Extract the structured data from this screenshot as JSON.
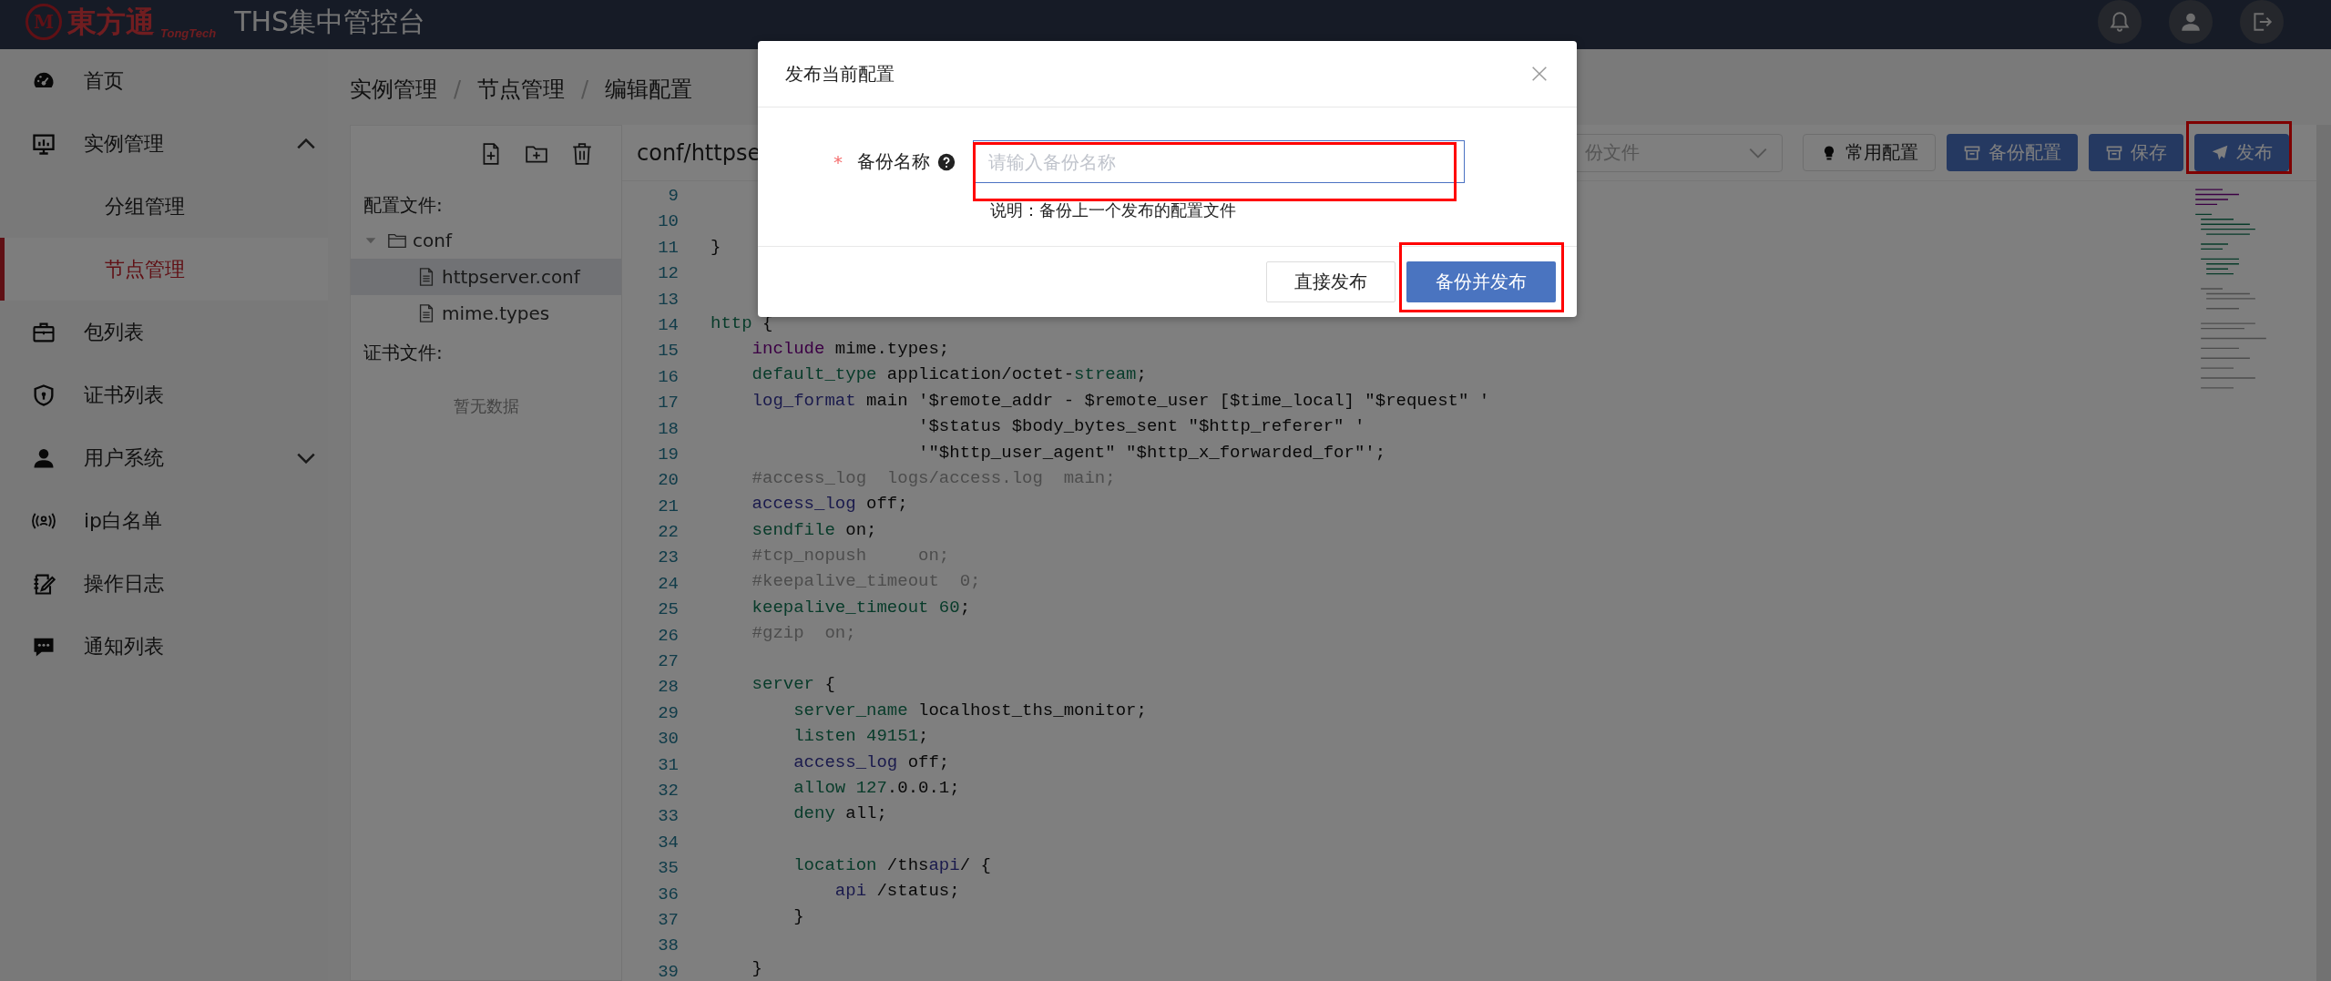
{
  "header": {
    "logo_mark": "M",
    "logo_text": "東方通",
    "logo_subtext": "TongTech",
    "title": "THS集中管控台"
  },
  "sidebar": {
    "items": [
      {
        "label": "首页",
        "kind": "link",
        "selected": false
      },
      {
        "label": "实例管理",
        "kind": "group",
        "selected": false,
        "expanded": true,
        "children": [
          {
            "label": "分组管理",
            "selected": false
          },
          {
            "label": "节点管理",
            "selected": true
          }
        ]
      },
      {
        "label": "包列表",
        "kind": "link",
        "selected": false
      },
      {
        "label": "证书列表",
        "kind": "link",
        "selected": false
      },
      {
        "label": "用户系统",
        "kind": "group",
        "selected": false,
        "expanded": false
      },
      {
        "label": "ip白名单",
        "kind": "link",
        "selected": false
      },
      {
        "label": "操作日志",
        "kind": "link",
        "selected": false
      },
      {
        "label": "通知列表",
        "kind": "link",
        "selected": false
      }
    ]
  },
  "breadcrumb": [
    {
      "kind": "link",
      "text": "实例管理"
    },
    {
      "kind": "separator",
      "text": "/"
    },
    {
      "kind": "link",
      "text": "节点管理"
    },
    {
      "kind": "separator",
      "text": "/"
    },
    {
      "kind": "current",
      "text": "编辑配置"
    }
  ],
  "file_panel": {
    "sections": [
      {
        "title": "配置文件:",
        "tree": [
          {
            "label": "conf",
            "kind": "folder",
            "expanded": true,
            "selected": false,
            "children": [
              {
                "label": "httpserver.conf",
                "kind": "file",
                "selected": true
              },
              {
                "label": "mime.types",
                "kind": "file",
                "selected": false
              }
            ]
          }
        ]
      },
      {
        "title": "证书文件:",
        "empty_text": "暂无数据"
      }
    ]
  },
  "editor": {
    "title": "conf/httpse",
    "backup_select": {
      "placeholder": "份文件"
    },
    "buttons": [
      {
        "label": "常用配置",
        "kind": "plain",
        "highlighted": false
      },
      {
        "label": "备份配置",
        "kind": "primary",
        "highlighted": false
      },
      {
        "label": "保存",
        "kind": "primary",
        "highlighted": false
      },
      {
        "label": "发布",
        "kind": "primary",
        "highlighted": true
      }
    ],
    "lines": [
      {
        "number": "9"
      },
      {
        "number": "10"
      },
      {
        "number": "11",
        "tokens": [
          {
            "kind": "plain",
            "text": "}"
          }
        ]
      },
      {
        "number": "12"
      },
      {
        "number": "13"
      },
      {
        "number": "14",
        "tokens": [
          {
            "kind": "directive",
            "text": "http"
          },
          {
            "kind": "plain",
            "text": " {"
          }
        ]
      },
      {
        "number": "15",
        "tokens": [
          {
            "kind": "include",
            "text": "    include"
          },
          {
            "kind": "plain",
            "text": " mime.types;"
          }
        ]
      },
      {
        "number": "16",
        "tokens": [
          {
            "kind": "directive",
            "text": "    default_type"
          },
          {
            "kind": "plain",
            "text": " application/octet-"
          },
          {
            "kind": "directive",
            "text": "stream"
          },
          {
            "kind": "plain",
            "text": ";"
          }
        ]
      },
      {
        "number": "17",
        "tokens": [
          {
            "kind": "variable",
            "text": "    log_format"
          },
          {
            "kind": "plain",
            "text": " main '$remote_addr - $remote_user [$time_local] \"$request\" '"
          }
        ]
      },
      {
        "number": "18",
        "tokens": [
          {
            "kind": "plain",
            "text": "                    '$status $body_bytes_sent \"$http_referer\" '"
          }
        ]
      },
      {
        "number": "19",
        "tokens": [
          {
            "kind": "plain",
            "text": "                    '\"$http_user_agent\" \"$http_x_forwarded_for\"';"
          }
        ]
      },
      {
        "number": "20",
        "tokens": [
          {
            "kind": "comment",
            "text": "    #access_log  logs/access.log  main;"
          }
        ]
      },
      {
        "number": "21",
        "tokens": [
          {
            "kind": "variable",
            "text": "    access_log"
          },
          {
            "kind": "plain",
            "text": " off;"
          }
        ]
      },
      {
        "number": "22",
        "tokens": [
          {
            "kind": "directive",
            "text": "    sendfile"
          },
          {
            "kind": "plain",
            "text": " on;"
          }
        ]
      },
      {
        "number": "23",
        "tokens": [
          {
            "kind": "comment",
            "text": "    #tcp_nopush     on;"
          }
        ]
      },
      {
        "number": "24",
        "tokens": [
          {
            "kind": "comment",
            "text": "    #keepalive_timeout  0;"
          }
        ]
      },
      {
        "number": "25",
        "tokens": [
          {
            "kind": "directive",
            "text": "    keepalive_timeout 60"
          },
          {
            "kind": "plain",
            "text": ";"
          }
        ]
      },
      {
        "number": "26",
        "tokens": [
          {
            "kind": "comment",
            "text": "    #gzip  on;"
          }
        ]
      },
      {
        "number": "27"
      },
      {
        "number": "28",
        "tokens": [
          {
            "kind": "directive",
            "text": "    server"
          },
          {
            "kind": "plain",
            "text": " {"
          }
        ]
      },
      {
        "number": "29",
        "tokens": [
          {
            "kind": "directive",
            "text": "        server_name"
          },
          {
            "kind": "plain",
            "text": " localhost_ths_monitor;"
          }
        ]
      },
      {
        "number": "30",
        "tokens": [
          {
            "kind": "directive",
            "text": "        listen 49151"
          },
          {
            "kind": "plain",
            "text": ";"
          }
        ]
      },
      {
        "number": "31",
        "tokens": [
          {
            "kind": "variable",
            "text": "        access_log"
          },
          {
            "kind": "plain",
            "text": " off;"
          }
        ]
      },
      {
        "number": "32",
        "tokens": [
          {
            "kind": "directive",
            "text": "        allow 127"
          },
          {
            "kind": "plain",
            "text": ".0.0.1;"
          }
        ]
      },
      {
        "number": "33",
        "tokens": [
          {
            "kind": "directive",
            "text": "        deny"
          },
          {
            "kind": "plain",
            "text": " all;"
          }
        ]
      },
      {
        "number": "34"
      },
      {
        "number": "35",
        "tokens": [
          {
            "kind": "directive",
            "text": "        location"
          },
          {
            "kind": "plain",
            "text": " /ths"
          },
          {
            "kind": "variable",
            "text": "api"
          },
          {
            "kind": "plain",
            "text": "/ {"
          }
        ]
      },
      {
        "number": "36",
        "tokens": [
          {
            "kind": "variable",
            "text": "            api"
          },
          {
            "kind": "plain",
            "text": " /status;"
          }
        ]
      },
      {
        "number": "37",
        "tokens": [
          {
            "kind": "plain",
            "text": "        }"
          }
        ]
      },
      {
        "number": "38"
      },
      {
        "number": "39",
        "tokens": [
          {
            "kind": "plain",
            "text": "    }"
          }
        ]
      }
    ]
  },
  "dialog": {
    "title": "发布当前配置",
    "field": {
      "required_mark": "*",
      "label": "备份名称",
      "placeholder": "请输入备份名称",
      "highlighted": true
    },
    "help": "说明：备份上一个发布的配置文件",
    "buttons": [
      {
        "label": "直接发布",
        "kind": "plain",
        "highlighted": false
      },
      {
        "label": "备份并发布",
        "kind": "primary",
        "highlighted": true
      }
    ]
  }
}
